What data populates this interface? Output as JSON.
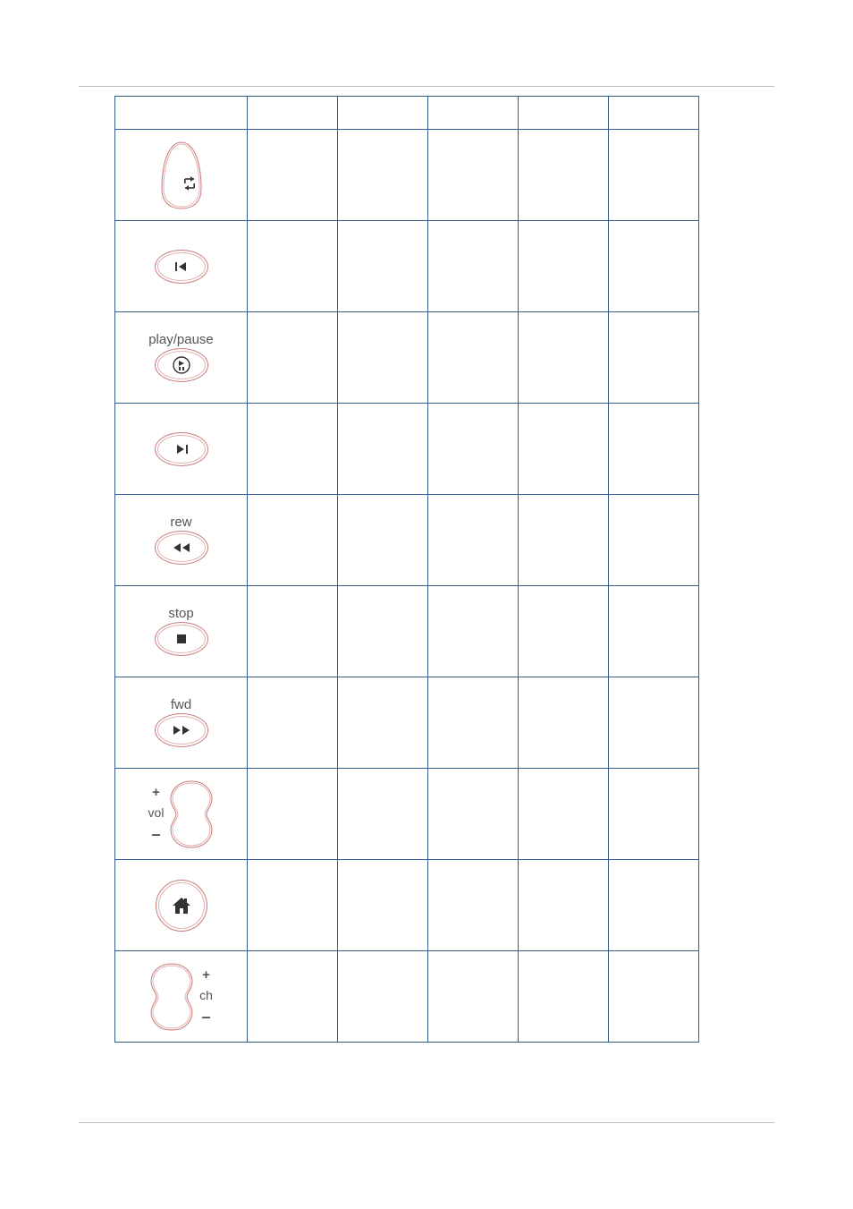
{
  "columns": 6,
  "rows": [
    {
      "id": "switch",
      "label": "",
      "icon": "switch"
    },
    {
      "id": "skip-back",
      "label": "",
      "icon": "skip-back"
    },
    {
      "id": "play-pause",
      "label": "play/pause",
      "icon": "play-pause"
    },
    {
      "id": "skip-fwd",
      "label": "",
      "icon": "skip-fwd"
    },
    {
      "id": "rew",
      "label": "rew",
      "icon": "rewind"
    },
    {
      "id": "stop",
      "label": "stop",
      "icon": "stop"
    },
    {
      "id": "fwd",
      "label": "fwd",
      "icon": "fast-fwd"
    },
    {
      "id": "vol",
      "label": "vol",
      "icon": "vol-blob",
      "plus": "+",
      "minus": "–"
    },
    {
      "id": "home",
      "label": "",
      "icon": "home"
    },
    {
      "id": "ch",
      "label": "ch",
      "icon": "ch-blob",
      "plus": "+",
      "minus": "–"
    }
  ]
}
